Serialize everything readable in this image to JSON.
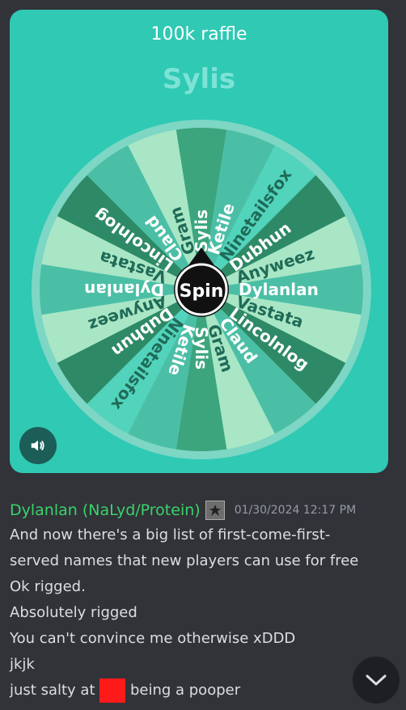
{
  "card": {
    "title": "100k raffle",
    "winner": "Sylis",
    "spin_label": "Spin"
  },
  "wheel": {
    "entries": [
      "Sylis",
      "Ketile",
      "Ninetailsfox",
      "Dubhun",
      "Anyweez",
      "Dylanlan",
      "Vastata",
      "Lincolnlog",
      "Claud",
      "Gram",
      "Sylis",
      "Ketile",
      "Ninetailsfox",
      "Dubhun",
      "Anyweez",
      "Dylanlan",
      "Vastata",
      "Lincolnlog",
      "Claud",
      "Gram"
    ],
    "colors": [
      "#3ca57d",
      "#4bbfa6",
      "#52d3bc",
      "#2e8a66",
      "#a8e6c5",
      "#4bbfa6",
      "#a8e6c5",
      "#2e8a66",
      "#4bbfa6",
      "#a8e6c5"
    ]
  },
  "message": {
    "author": "Dylanlan (NaLyd/Protein)",
    "timestamp": "01/30/2024 12:17 PM",
    "lines": [
      "And now there's a big list of first-come-first-served names that new players can use for free",
      "Ok rigged.",
      "Absolutely rigged",
      "You can't convince me otherwise xDDD",
      "jkjk"
    ],
    "last_line_before": "just salty at ",
    "last_line_after": " being a pooper"
  }
}
